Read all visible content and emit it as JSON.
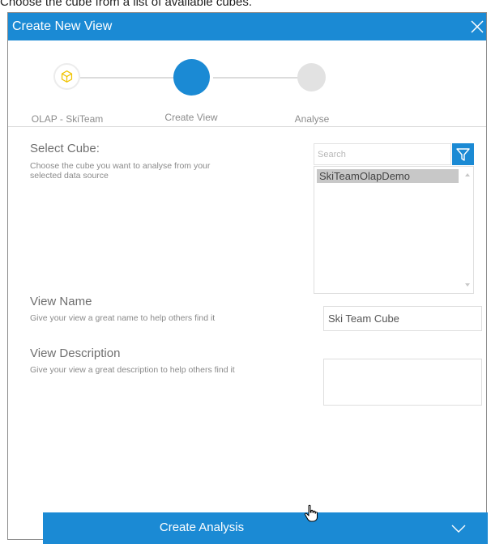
{
  "caption": "Choose the cube from a list of available cubes.",
  "dialog": {
    "title": "Create New View",
    "close_icon": "close-icon"
  },
  "steps": [
    {
      "label": "OLAP - SkiTeam",
      "state": "completed",
      "icon": "cube-icon"
    },
    {
      "label": "Create View",
      "state": "active"
    },
    {
      "label": "Analyse",
      "state": "pending"
    }
  ],
  "select_cube": {
    "title": "Select Cube:",
    "description": "Choose the cube you want to analyse from your selected data source",
    "search_placeholder": "Search",
    "filter_icon": "filter-icon",
    "items": [
      "SkiTeamOlapDemo"
    ],
    "selected": "SkiTeamOlapDemo"
  },
  "view_name": {
    "title": "View Name",
    "description": "Give your view a great name to help others find it",
    "value": "Ski Team Cube"
  },
  "view_description": {
    "title": "View Description",
    "description": "Give your view a great description to help others find it",
    "value": ""
  },
  "action": {
    "label": "Create Analysis",
    "chevron_icon": "chevron-down-icon"
  },
  "colors": {
    "accent": "#1b8ad4",
    "step_pending": "#e2e2e2",
    "step_completed_ring": "#f0f0f0",
    "cube_icon": "#f0c300"
  }
}
